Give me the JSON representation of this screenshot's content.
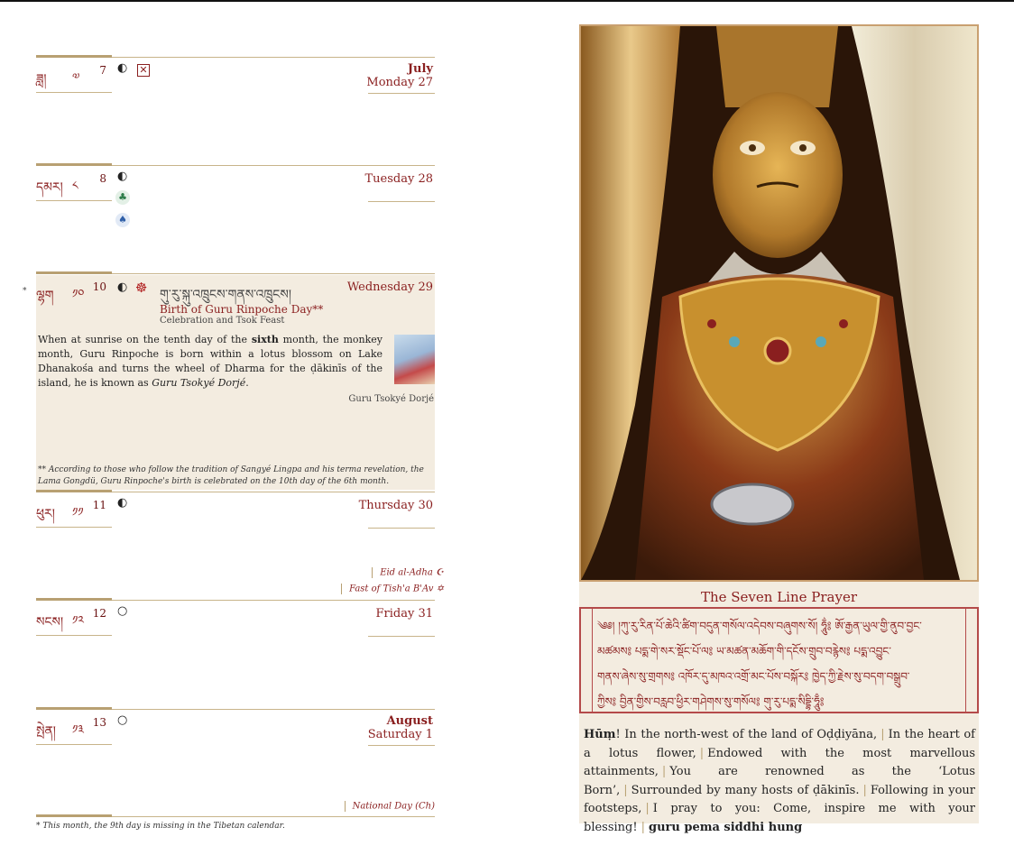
{
  "days": [
    {
      "tib_name": "ཟླ།",
      "tib_num": "༧",
      "lunar": "7",
      "month": "July",
      "date": "Monday 27",
      "moon": "◐"
    },
    {
      "tib_name": "དམར།",
      "tib_num": "༨",
      "lunar": "8",
      "date": "Tuesday 28",
      "moon": "◐"
    },
    {
      "tib_name": "ལྷག",
      "tib_num": "༡༠",
      "lunar": "10",
      "date": "Wednesday 29",
      "moon": "◐"
    },
    {
      "tib_name": "ཕུར།",
      "tib_num": "༡༡",
      "lunar": "11",
      "date": "Thursday 30",
      "moon": "◐"
    },
    {
      "tib_name": "སངས།",
      "tib_num": "༡༢",
      "lunar": "12",
      "date": "Friday 31",
      "moon": "○"
    },
    {
      "tib_name": "སྤེན།",
      "tib_num": "༡༣",
      "lunar": "13",
      "month": "August",
      "date": "Saturday 1",
      "moon": "○"
    }
  ],
  "wednesday": {
    "star": "*",
    "tib_title": "གུ་རུ་སྐུ་འཁྲུངས་གནས་འཁྲུངས།",
    "title": "Birth of Guru Rinpoche Day**",
    "subtitle": "Celebration and Tsok Feast",
    "para_1": "When at sunrise on the tenth day of the ",
    "para_bold": "sixth",
    "para_2": " month, the monkey month, Guru Rinpoche is born within a lotus blossom on Lake Dhanakośa and turns the wheel of Dharma for the ḍākinīs of the island, he is known as ",
    "para_italic": "Guru Tsokyé Dorjé",
    "para_3": ".",
    "image_caption": "Guru Tsokyé Dorjé",
    "footnote": "** According to those who follow the tradition of Sangyé Lingpa and his terma revelation, the Lama Gongdü, Guru Rinpoche's birth is celebrated on the 10th day of the 6th month."
  },
  "notes": {
    "eid": "Eid al-Adha",
    "eid_icon": "☪",
    "tisha": "Fast of Tish'a B'Av",
    "tisha_icon": "✡",
    "national": "National Day (Ch)"
  },
  "icons": {
    "box_x": "✕",
    "dharma_wheel": "☸",
    "green_deity": "♣",
    "blue_deity": "♠"
  },
  "page_footnote": "* This month, the 9th day is missing in the Tibetan calendar.",
  "prayer": {
    "title": "The Seven Line Prayer",
    "tib_lines": [
      "༄༅། །ཀུ་རུ་རིན་པོ་ཆེའི་ཚིག་བདུན་གསོལ་འདེབས་བཞུགས་སོ།  ཧཱུྂ༔  ཨོ་རྒྱན་ཡུལ་གྱི་ནུབ་བྱང་",
      "མཚམས༔  པདྨ་གེ་སར་སྡོང་པོ་ལ༔  ཡ་མཚན་མཆོག་གི་དངོས་གྲུབ་བརྙེས༔  པདྨ་འབྱུང་",
      "གནས་ཞེས་སུ་གྲགས༔  འཁོར་དུ་མཁའ་འགྲོ་མང་པོས་བསྐོར༔  ཁྱེད་ཀྱི་རྗེས་སུ་བདག་བསྒྲུབ་",
      "ཀྱིས༔  བྱིན་གྱིས་བརླབ་ཕྱིར་གཤེགས་སུ་གསོལ༔  གུ་རུ་པདྨ་སིདྡྷི་ཧཱུྃ༔"
    ],
    "hum": "Hūṃ",
    "lines": [
      "! In the north-west of the land of Oḍḍiyāna,",
      "In the heart of a lotus flower,",
      "Endowed with the most marvellous attainments,",
      "You are renowned as the ‘Lotus Born’,",
      "Surrounded by many hosts of ḍākinīs.",
      "Following in your footsteps,",
      "I pray to you: Come, inspire me with your blessing!"
    ],
    "mantra": "guru pema siddhi hung",
    "sep": "|"
  }
}
